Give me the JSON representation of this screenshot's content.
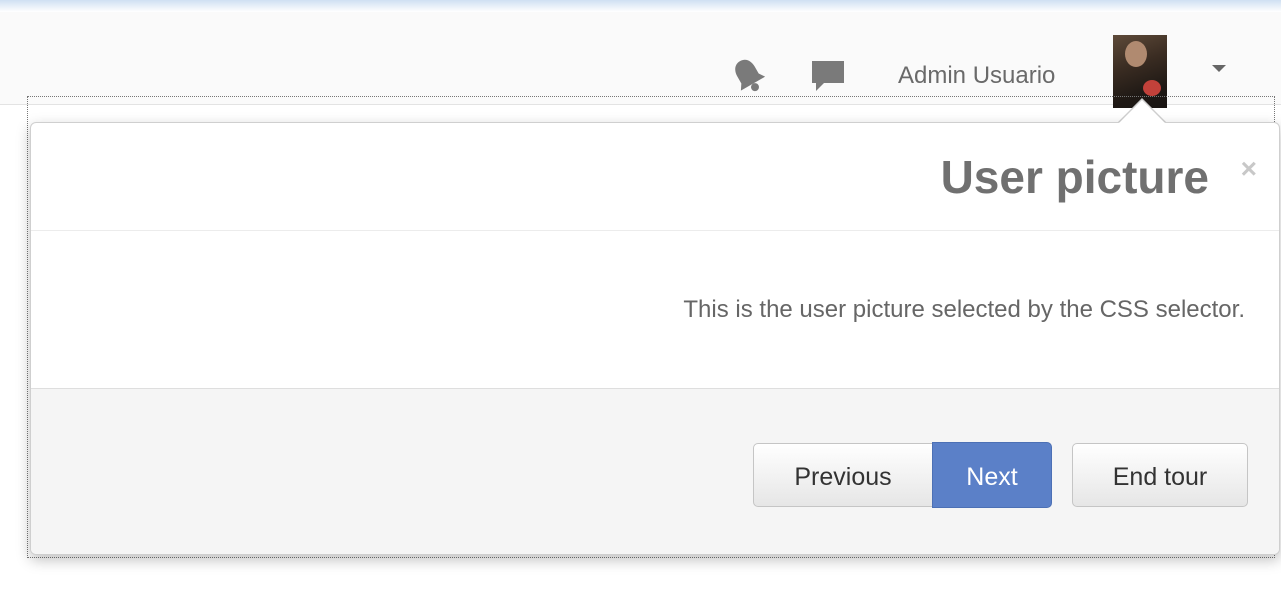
{
  "navbar": {
    "icons": {
      "notifications": "bell-icon",
      "messages": "chat-bubble-icon"
    },
    "user_name": "Admin Usuario"
  },
  "tour": {
    "title": "User picture",
    "close_label": "×",
    "content": "This is the user picture selected by the CSS selector.",
    "buttons": {
      "previous": "Previous",
      "next": "Next",
      "end": "End tour"
    }
  },
  "colors": {
    "primary": "#5b80c8",
    "title": "#707070",
    "text": "#666666"
  }
}
